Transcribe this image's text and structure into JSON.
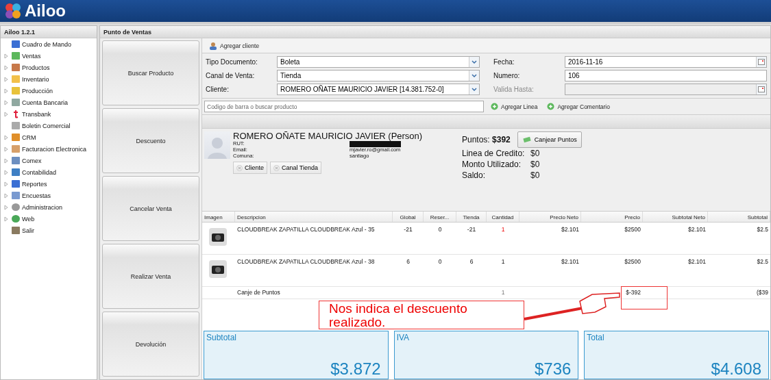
{
  "header": {
    "logo": "Ailoo"
  },
  "sidebar": {
    "title": "Ailoo 1.2.1",
    "items": [
      {
        "label": "Cuadro de Mando",
        "expandable": false
      },
      {
        "label": "Ventas",
        "expandable": true
      },
      {
        "label": "Productos",
        "expandable": true
      },
      {
        "label": "Inventario",
        "expandable": true
      },
      {
        "label": "Producción",
        "expandable": true
      },
      {
        "label": "Cuenta Bancaria",
        "expandable": true
      },
      {
        "label": "Transbank",
        "expandable": true
      },
      {
        "label": "Boletin Comercial",
        "expandable": false
      },
      {
        "label": "CRM",
        "expandable": true
      },
      {
        "label": "Facturacion Electronica",
        "expandable": true
      },
      {
        "label": "Comex",
        "expandable": true
      },
      {
        "label": "Contabilidad",
        "expandable": true
      },
      {
        "label": "Reportes",
        "expandable": true
      },
      {
        "label": "Encuestas",
        "expandable": true
      },
      {
        "label": "Administracion",
        "expandable": true
      },
      {
        "label": "Web",
        "expandable": true
      },
      {
        "label": "Salir",
        "expandable": false
      }
    ]
  },
  "panel": {
    "title": "Punto de Ventas",
    "actions": [
      "Buscar Producto",
      "Descuento",
      "Cancelar Venta",
      "Realizar Venta",
      "Devolución"
    ],
    "toolbar": {
      "add_client": "Agregar cliente"
    },
    "form": [
      {
        "label": "Tipo Documento:",
        "value": "Boleta",
        "kind": "select",
        "disabled": false
      },
      {
        "label": "Fecha:",
        "value": "2016-11-16",
        "kind": "date",
        "disabled": false
      },
      {
        "label": "Canal de Venta:",
        "value": "Tienda",
        "kind": "select",
        "disabled": false
      },
      {
        "label": "Numero:",
        "value": "106",
        "kind": "text",
        "disabled": false
      },
      {
        "label": "Cliente:",
        "value": "ROMERO OÑATE MAURICIO JAVIER [14.381.752-0]",
        "kind": "select",
        "disabled": false
      },
      {
        "label": "Valida Hasta:",
        "kind": "date",
        "disabled": true
      }
    ],
    "search": {
      "placeholder": "Codigo de barra o buscar producto",
      "add_line": "Agregar Linea",
      "add_comment": "Agregar Comentario"
    },
    "client": {
      "name": "ROMERO OÑATE MAURICIO JAVIER (Person)",
      "fields": [
        {
          "label": "RUT:"
        },
        {
          "label": "Email:",
          "value": "mjavier.ro@gmail.com"
        },
        {
          "label": "Comuna:",
          "value": "santiago"
        }
      ],
      "tags": [
        "Cliente",
        "Canal Tienda"
      ],
      "points_label": "Puntos:",
      "points": "$392",
      "redeem": "Canjear Puntos",
      "credit": [
        {
          "label": "Linea de Credito:",
          "value": "$0"
        },
        {
          "label": "Monto Utilizado:",
          "value": "$0"
        },
        {
          "label": "Saldo:",
          "value": "$0"
        }
      ]
    },
    "table": {
      "columns": [
        "Imagen",
        "Descripcion",
        "Global",
        "Reser...",
        "Tienda",
        "Cantidad",
        "Precio Neto",
        "Precio",
        "Subtotal Neto",
        "Subtotal"
      ],
      "rows": [
        {
          "kind": "product",
          "cells": [
            "",
            "CLOUDBREAK ZAPATILLA CLOUDBREAK Azul - 35",
            "-21",
            "0",
            "-21",
            "1",
            "$2.101",
            "$2500",
            "$2.101",
            "$2.5"
          ],
          "warn": true
        },
        {
          "kind": "product",
          "cells": [
            "",
            "CLOUDBREAK ZAPATILLA CLOUDBREAK Azul - 38",
            "6",
            "0",
            "6",
            "1",
            "$2.101",
            "$2500",
            "$2.101",
            "$2.5"
          ],
          "warn": false
        },
        {
          "kind": "discount",
          "cells": [
            "",
            "Canje de Puntos",
            "",
            "",
            "",
            "1",
            "",
            "$-392",
            "",
            "($39"
          ],
          "warn": false
        }
      ]
    },
    "totals": [
      {
        "label": "Subtotal",
        "value": "$3.872"
      },
      {
        "label": "IVA",
        "value": "$736"
      },
      {
        "label": "Total",
        "value": "$4.608"
      }
    ]
  },
  "callout": {
    "text": "Nos indica el descuento realizado."
  }
}
